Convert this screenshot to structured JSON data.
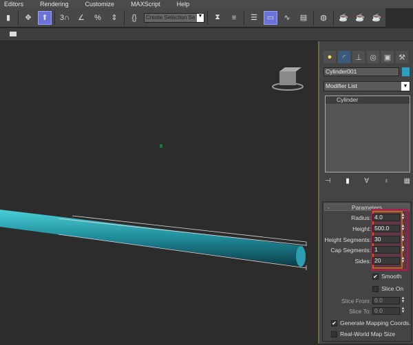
{
  "menu": [
    "Editors",
    "Rendering",
    "Customize",
    "MAXScript",
    "Help"
  ],
  "toolbar": {
    "selection_set": "Create Selection Se",
    "icons": [
      "bookmark-icon",
      "move-icon",
      "select-object-icon",
      "snap-3d-icon",
      "angle-snap-icon",
      "percent-snap-icon",
      "spinner-snap-icon",
      "edit-named-sets-icon",
      "mirror-icon",
      "align-icon",
      "layers-icon",
      "graphite-icon",
      "curve-editor-icon",
      "schematic-icon",
      "material-editor-icon",
      "render-setup-icon",
      "render-frame-icon",
      "render-icon"
    ]
  },
  "panel": {
    "object_name": "Cylinder001",
    "object_color": "#2f9fc0",
    "modifier_list": "Modifier List",
    "stack": [
      "Cylinder"
    ],
    "rollout_title": "Parameters",
    "collapse": "-",
    "params": [
      {
        "label": "Radius:",
        "value": "4.0"
      },
      {
        "label": "Height:",
        "value": "500.0"
      },
      {
        "label": "Height Segments:",
        "value": "30"
      },
      {
        "label": "Cap Segments:",
        "value": "1"
      },
      {
        "label": "Sides:",
        "value": "20"
      }
    ],
    "smooth": {
      "label": "Smooth",
      "checked": true
    },
    "slice_on": {
      "label": "Slice On",
      "checked": false
    },
    "slice_from": {
      "label": "Slice From:",
      "value": "0.0"
    },
    "slice_to": {
      "label": "Slice To:",
      "value": "0.0"
    },
    "gen_mapping": {
      "label": "Generate Mapping Coords.",
      "checked": true
    },
    "real_world": {
      "label": "Real-World Map Size",
      "checked": false
    },
    "highlight_color": "#b01a4a"
  }
}
